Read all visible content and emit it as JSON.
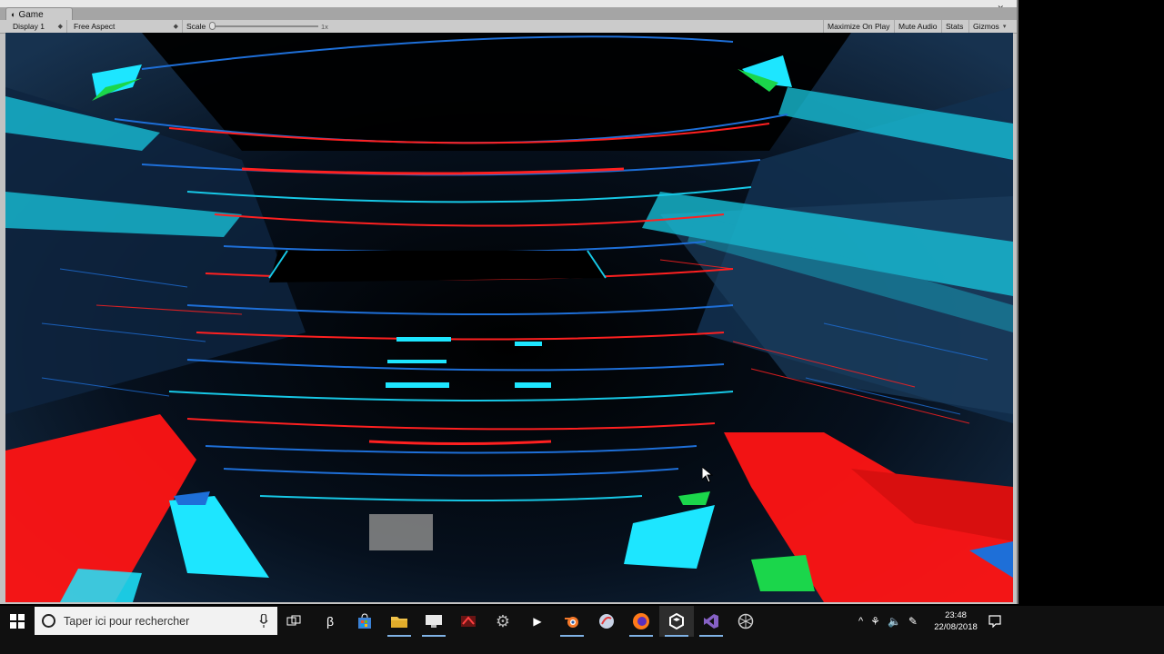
{
  "window": {
    "tab_label": "Game",
    "controls": [
      "▫",
      "✕"
    ]
  },
  "toolbar": {
    "display": "Display 1",
    "aspect": "Free Aspect",
    "scale_label": "Scale",
    "scale_value": "1x",
    "scale_level": 0.0,
    "maximize_on_play": "Maximize On Play",
    "mute_audio": "Mute Audio",
    "stats": "Stats",
    "gizmos": "Gizmos"
  },
  "taskbar": {
    "search_placeholder": "Taper ici pour rechercher",
    "apps": [
      "task-view",
      "app-b",
      "store",
      "file-explorer",
      "display",
      "app-red",
      "app-gear",
      "media-player",
      "blender",
      "app-circle",
      "firefox",
      "unity",
      "visual-studio",
      "app-web"
    ],
    "time": "23:48",
    "date": "22/08/2018"
  },
  "colors": {
    "cyan": "#19d6ee",
    "red": "#ff1414",
    "blue": "#1e6fd8",
    "green": "#16d34a",
    "dark": "#071423"
  }
}
